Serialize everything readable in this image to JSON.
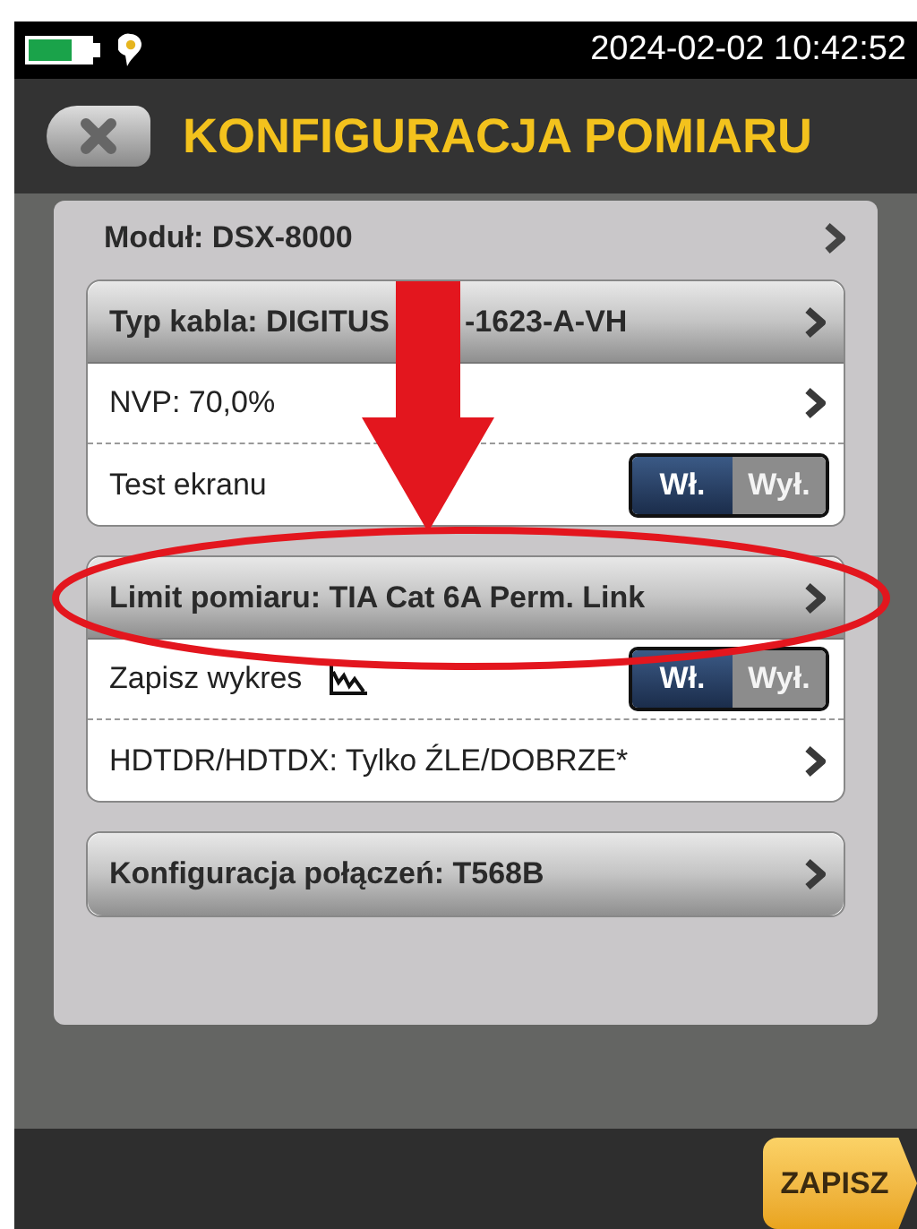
{
  "status_bar": {
    "datetime": "2024-02-02 10:42:52"
  },
  "header": {
    "title": "KONFIGURACJA POMIARU"
  },
  "module": {
    "label": "Moduł: DSX-8000"
  },
  "groups": [
    {
      "rows": [
        {
          "kind": "header",
          "label_parts": [
            "Typ kabla: DIGITUS",
            "-1623-A-VH"
          ],
          "arrow_over": true
        },
        {
          "kind": "link",
          "label": "NVP: 70,0%"
        },
        {
          "kind": "toggle",
          "label": "Test ekranu",
          "on": true,
          "on_label": "Wł.",
          "off_label": "Wył."
        }
      ]
    },
    {
      "rows": [
        {
          "kind": "header",
          "label_parts": [
            "Limit pomiaru: TIA Cat 6A Perm. Link"
          ],
          "circled": true
        },
        {
          "kind": "toggle",
          "label": "Zapisz wykres",
          "graph_icon": true,
          "on": true,
          "on_label": "Wł.",
          "off_label": "Wył."
        },
        {
          "kind": "link",
          "label": "HDTDR/HDTDX: Tylko ŹLE/DOBRZE*"
        }
      ]
    },
    {
      "rows": [
        {
          "kind": "header",
          "label_parts": [
            "Konfiguracja połączeń: T568B"
          ]
        }
      ]
    }
  ],
  "footer": {
    "button": "ZAPISZ"
  }
}
